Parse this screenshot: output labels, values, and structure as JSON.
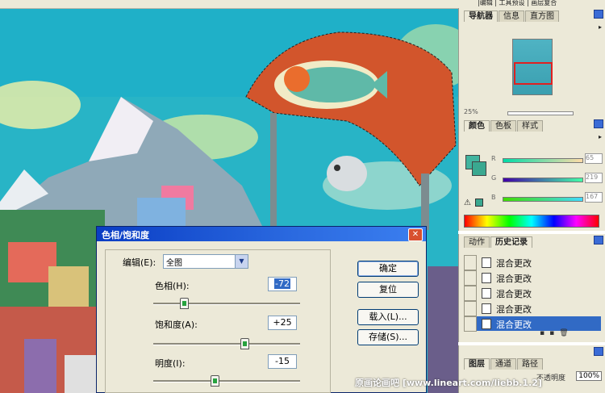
{
  "topbar": {
    "text": "|编辑 | 工具预设 | 画层复合"
  },
  "navigator": {
    "tabs": [
      "导航器",
      "信息",
      "直方图"
    ],
    "zoom": "25%"
  },
  "color": {
    "tabs": [
      "颜色",
      "色板",
      "样式"
    ],
    "channels": [
      {
        "label": "R",
        "value": "65"
      },
      {
        "label": "G",
        "value": "219"
      },
      {
        "label": "B",
        "value": "167"
      }
    ]
  },
  "history": {
    "tabs": [
      "动作",
      "历史记录"
    ],
    "items": [
      "混合更改",
      "混合更改",
      "混合更改",
      "混合更改",
      "混合更改"
    ],
    "selected_index": 4
  },
  "layers": {
    "tabs": [
      "图层",
      "通道",
      "路径"
    ],
    "opacity_label": "不透明度",
    "opacity": "100%"
  },
  "dialog": {
    "title": "色相/饱和度",
    "edit_label": "编辑(E):",
    "edit_value": "全图",
    "hue_label": "色相(H):",
    "hue_value": "-72",
    "saturation_label": "饱和度(A):",
    "saturation_value": "+25",
    "lightness_label": "明度(I):",
    "lightness_value": "-15",
    "ok_button": "确定",
    "reset_button": "复位",
    "load_button": "载入(L)...",
    "save_button": "存储(S)...",
    "colors": {
      "title_bar": "#0a3dc4",
      "accent": "#316AC5"
    }
  },
  "watermark": "原画论画吧  [www.lineart.com/liebb.1.2]"
}
